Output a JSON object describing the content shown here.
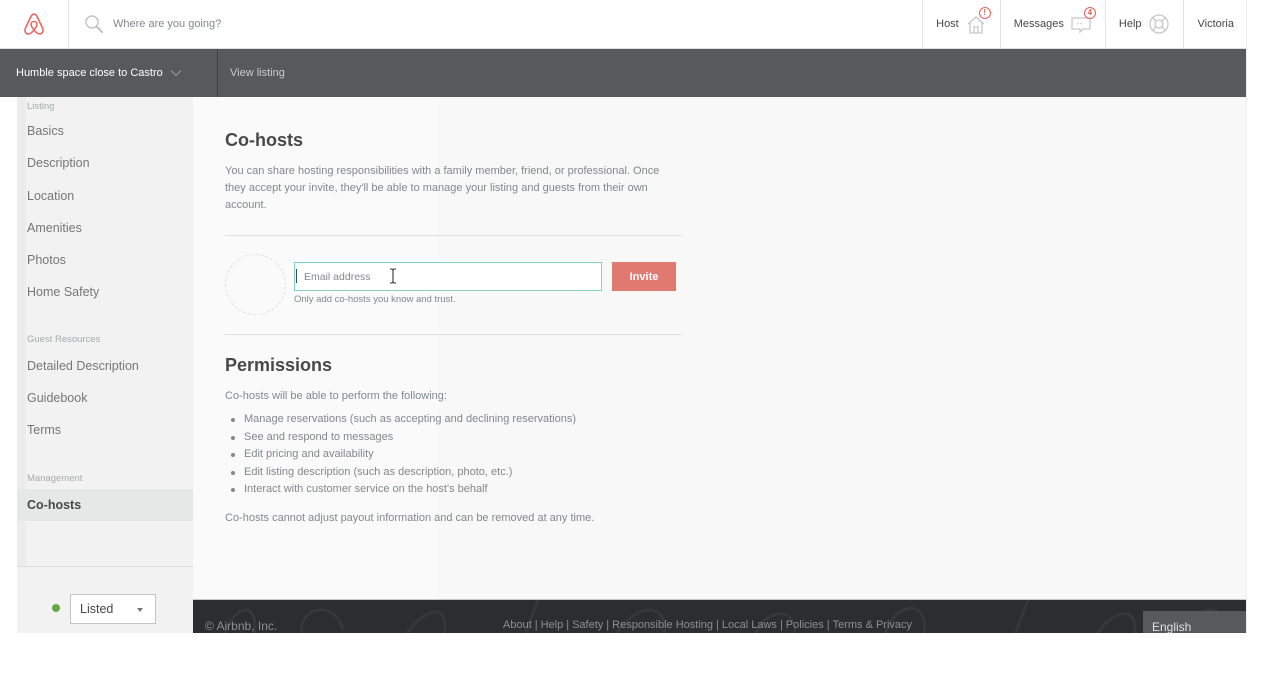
{
  "header": {
    "logo": "airbnb-logo",
    "search_placeholder": "Where are you going?",
    "nav": [
      {
        "label": "Host",
        "icon": "house-icon",
        "badge": "!"
      },
      {
        "label": "Messages",
        "icon": "chat-bubble-icon",
        "badge": "4"
      },
      {
        "label": "Help",
        "icon": "lifebuoy-icon"
      },
      {
        "label": "Victoria"
      }
    ]
  },
  "subheader": {
    "listing_name": "Humble space close to Castro",
    "view_listing": "View listing"
  },
  "sidebar": {
    "groups": [
      {
        "title": "Listing",
        "items": [
          "Basics",
          "Description",
          "Location",
          "Amenities",
          "Photos",
          "Home Safety"
        ]
      },
      {
        "title": "Guest Resources",
        "items": [
          "Detailed Description",
          "Guidebook",
          "Terms"
        ]
      },
      {
        "title": "Management",
        "items": [
          "Co-hosts"
        ]
      }
    ],
    "active_item": "Co-hosts",
    "status": {
      "value": "Listed",
      "color": "#6aa54a"
    }
  },
  "main": {
    "title": "Co-hosts",
    "intro": "You can share hosting responsibilities with a family member, friend, or professional. Once they accept your invite, they'll be able to manage your listing and guests from their own account.",
    "email_placeholder": "Email address",
    "invite_label": "Invite",
    "hint": "Only add co-hosts you know and trust.",
    "permissions_title": "Permissions",
    "permissions_intro": "Co-hosts will be able to perform the following:",
    "permissions": [
      "Manage reservations (such as accepting and declining reservations)",
      "See and respond to messages",
      "Edit pricing and availability",
      "Edit listing description (such as description, photo, etc.)",
      "Interact with customer service on the host's behalf"
    ],
    "permissions_footer": "Co-hosts cannot adjust payout information and can be removed at any time."
  },
  "footer": {
    "copyright": "© Airbnb, Inc.",
    "links": [
      "About",
      "Help",
      "Safety",
      "Responsible Hosting",
      "Local Laws",
      "Policies",
      "Terms & Privacy"
    ],
    "language": "English"
  },
  "colors": {
    "brand": "#ff5a5f",
    "invite_button": "#e07a70",
    "input_focus": "#7fd3c4",
    "subheader_bg": "#565a5c",
    "footer_bg": "#2c2d2e"
  }
}
